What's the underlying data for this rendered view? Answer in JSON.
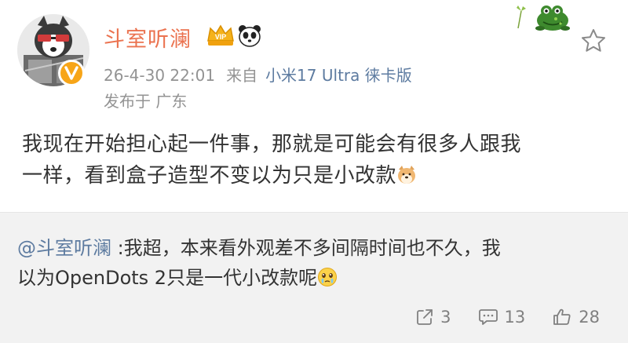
{
  "post": {
    "username": "斗室听澜",
    "timestamp": "26-4-30 22:01",
    "from_label": "来自",
    "device": "小米17 Ultra 徕卡版",
    "location": "发布于 广东",
    "text_line1": "我现在开始担心起一件事，那就是可能会有很多人跟我",
    "text_line2": "一样，看到盒子造型不变以为只是小改款"
  },
  "repost": {
    "mention": "@斗室听澜",
    "text_line1_rest": " :我超，本来看外观差不多间隔时间也不久，我",
    "text_line2": "以为OpenDots 2只是一代小改款呢"
  },
  "actions": {
    "repost_count": "3",
    "comment_count": "13",
    "like_count": "28"
  },
  "icons": {
    "vip": "vip-badge-icon",
    "panda": "panda-icon",
    "favorite": "star-outline-icon",
    "dog_emoji": "dog-face-emoji",
    "crying_emoji": "teary-face-emoji",
    "repost": "repost-icon",
    "comment": "comment-icon",
    "like": "thumbs-up-icon"
  },
  "colors": {
    "username": "#eb7350",
    "link": "#5d7ba0",
    "meta": "#939393",
    "repost_bg": "#f2f2f2",
    "verified": "#f7a518"
  }
}
